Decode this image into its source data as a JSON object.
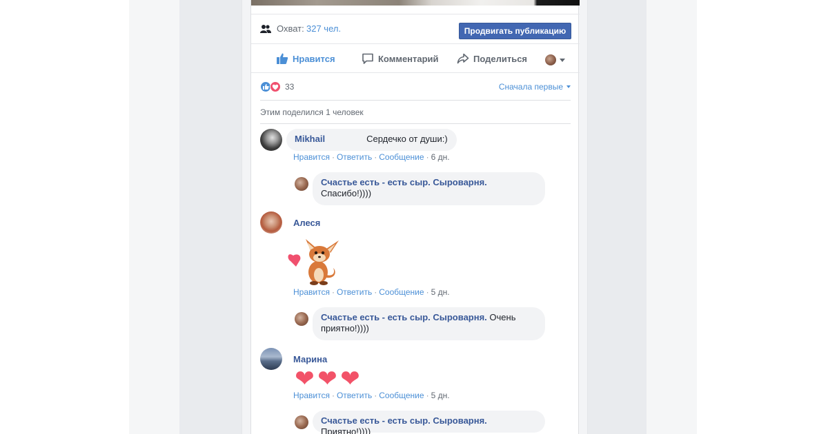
{
  "post": {
    "reach_label": "Охват:",
    "reach_count": "327 чел.",
    "promote_button": "Продвигать публикацию"
  },
  "actions": {
    "like": "Нравится",
    "comment": "Комментарий",
    "share": "Поделиться"
  },
  "reactions": {
    "count": "33",
    "sort_label": "Сначала первые"
  },
  "shared_text": "Этим поделился 1 человек",
  "comments": [
    {
      "author": "Mikhail",
      "text": "Сердечко от души:)",
      "actions": [
        "Нравится",
        "Ответить",
        "Сообщение"
      ],
      "time": "6 дн.",
      "reply": {
        "author": "Счастье есть - есть сыр. Сыроварня.",
        "text": "Спасибо!))))"
      }
    },
    {
      "author": "Алеся",
      "attachment": "fox-with-heart-sticker",
      "actions": [
        "Нравится",
        "Ответить",
        "Сообщение"
      ],
      "time": "5 дн.",
      "reply": {
        "author": "Счастье есть - есть сыр. Сыроварня.",
        "text_line1": "Очень",
        "text_line2": "приятно!))))"
      }
    },
    {
      "author": "Марина",
      "text": "❤❤❤",
      "actions": [
        "Нравится",
        "Ответить",
        "Сообщение"
      ],
      "time": "5 дн.",
      "reply": {
        "author": "Счастье есть - есть сыр. Сыроварня.",
        "text": "Приятно!))))"
      }
    }
  ],
  "colors": {
    "link_blue": "#4b8fd6",
    "author_blue": "#385898",
    "button_blue": "#4267b2",
    "heart_red": "#f25268"
  }
}
